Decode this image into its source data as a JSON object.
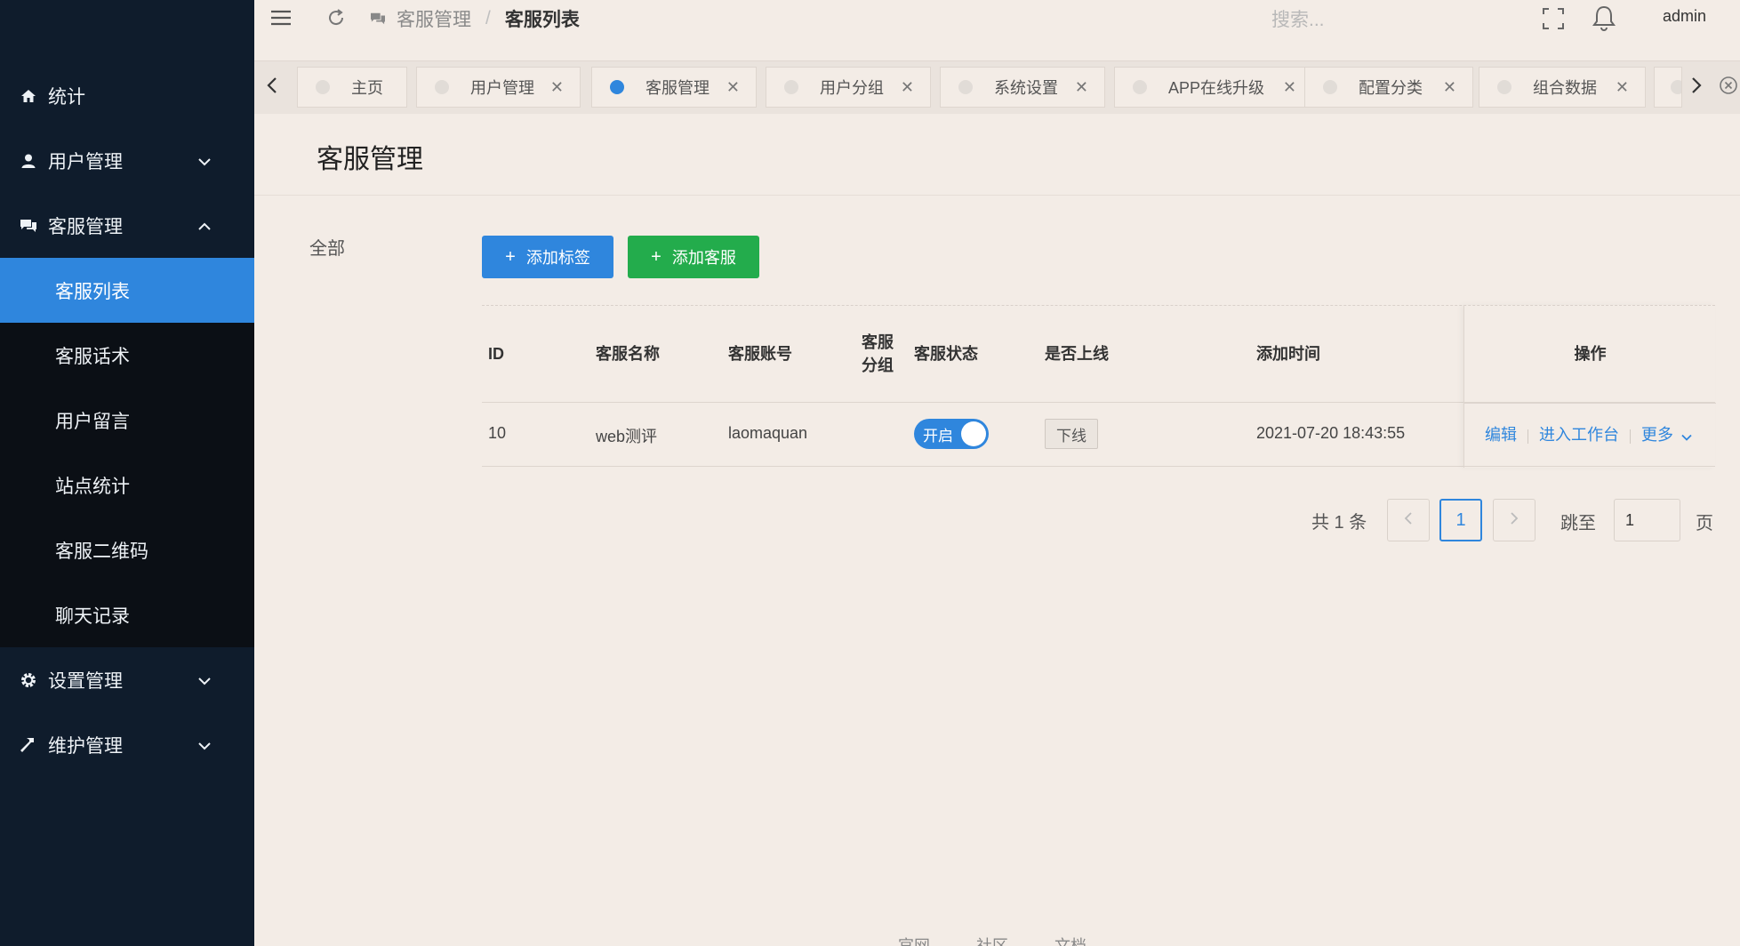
{
  "sidebar": {
    "items": [
      {
        "label": "统计",
        "icon": "home-icon"
      },
      {
        "label": "用户管理",
        "icon": "user-icon"
      },
      {
        "label": "客服管理",
        "icon": "chat-icon"
      },
      {
        "label": "设置管理",
        "icon": "gear-icon"
      },
      {
        "label": "维护管理",
        "icon": "hammer-icon"
      }
    ],
    "submenu": [
      "客服列表",
      "客服话术",
      "用户留言",
      "站点统计",
      "客服二维码",
      "聊天记录"
    ]
  },
  "header": {
    "breadcrumb_parent": "客服管理",
    "breadcrumb_sep": "/",
    "breadcrumb_current": "客服列表",
    "search_placeholder": "搜索...",
    "user": "admin"
  },
  "tabs": [
    "主页",
    "用户管理",
    "客服管理",
    "用户分组",
    "系统设置",
    "APP在线升级",
    "配置分类",
    "组合数据"
  ],
  "page": {
    "title": "客服管理",
    "left_panel": "全部"
  },
  "toolbar": {
    "add_tag": "添加标签",
    "add_staff": "添加客服"
  },
  "table": {
    "headers": {
      "id": "ID",
      "name": "客服名称",
      "account": "客服账号",
      "group_1": "客服",
      "group_2": "分组",
      "status": "客服状态",
      "online": "是否上线",
      "time": "添加时间",
      "ops": "操作"
    },
    "rows": [
      {
        "id": "10",
        "name": "web测评",
        "account": "laomaquan",
        "group": "",
        "status_label": "开启",
        "online_label": "下线",
        "time": "2021-07-20 18:43:55",
        "op_edit": "编辑",
        "op_workbench": "进入工作台",
        "op_more": "更多"
      }
    ]
  },
  "pagination": {
    "total": "共 1 条",
    "current": "1",
    "jump_label": "跳至",
    "jump_value": "1",
    "page_unit": "页"
  },
  "footer": [
    "官网",
    "社区",
    "文档"
  ],
  "colors": {
    "primary": "#2f86dd",
    "success": "#23ac4c",
    "sidebar_bg": "#0f1c2c"
  }
}
